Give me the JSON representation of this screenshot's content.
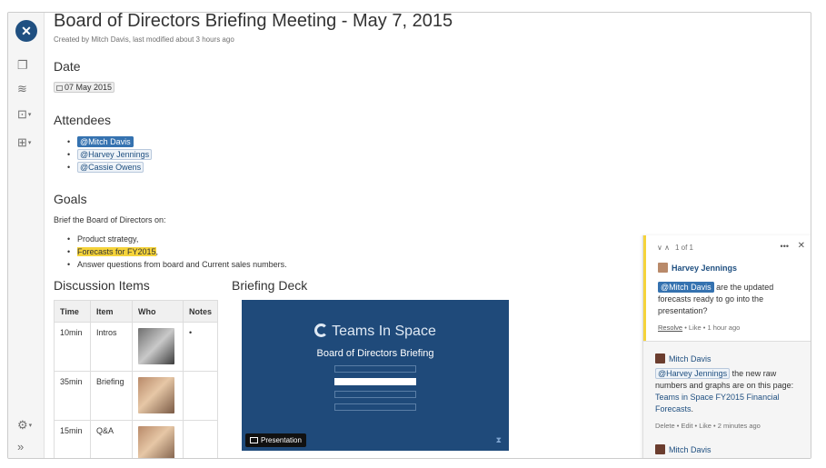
{
  "sidebar": {
    "logo_icon": "confluence-logo-icon",
    "icons": [
      "pages-icon",
      "feed-icon",
      "create-icon",
      "tree-icon"
    ],
    "bottom_icons": [
      "settings-icon",
      "expand-icon"
    ],
    "expand_label": "»"
  },
  "page": {
    "title": "Board of Directors Briefing Meeting - May 7, 2015",
    "byline": "Created by Mitch Davis, last modified about 3 hours ago",
    "date_heading": "Date",
    "date_value": "07 May 2015",
    "attendees_heading": "Attendees",
    "attendees": [
      {
        "label": "@Mitch Davis"
      },
      {
        "label": "@Harvey Jennings"
      },
      {
        "label": "@Cassie Owens"
      }
    ],
    "goals_heading": "Goals",
    "goals_intro": "Brief the Board of Directors on:",
    "goals": {
      "item1": "Product strategy,",
      "item2_highlight": "Forecasts for FY2015",
      "item2_suffix": ",",
      "item3": "Answer questions from board and Current sales numbers."
    },
    "discussion_heading": "Discussion Items",
    "deck_heading": "Briefing Deck"
  },
  "table": {
    "headers": [
      "Time",
      "Item",
      "Who",
      "Notes"
    ],
    "rows": [
      {
        "time": "10min",
        "item": "Intros",
        "notes": "•"
      },
      {
        "time": "35min",
        "item": "Briefing",
        "notes": ""
      },
      {
        "time": "15min",
        "item": "Q&A",
        "notes": ""
      }
    ]
  },
  "deck": {
    "brand": "Teams In Space",
    "subtitle": "Board of Directors Briefing",
    "button_label": "Presentation",
    "bg_color": "#1f4a7a"
  },
  "comments": {
    "nav": {
      "position": "1 of 1",
      "more": "•••",
      "close": "✕"
    },
    "first": {
      "author": "Harvey Jennings",
      "mention": "@Mitch Davis",
      "text": " are the updated forecasts ready to go into the presentation?",
      "resolve": "Resolve",
      "meta": " • Like • 1 hour ago"
    },
    "second": {
      "author": "Mitch Davis",
      "mention": "@Harvey Jennings",
      "text": " the new raw numbers and graphs are on this page: ",
      "link": "Teams in Space FY2015 Financial Forecasts",
      "after_link": ".",
      "meta": "Delete • Edit • Like • 2 minutes ago"
    },
    "third": {
      "author": "Mitch Davis"
    },
    "accent_color": "#f5d33a"
  }
}
